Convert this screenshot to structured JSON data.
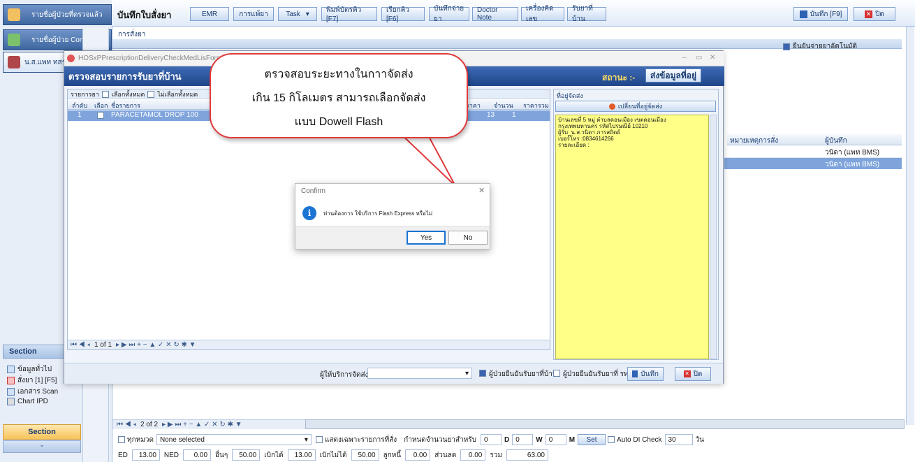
{
  "leftnav": {
    "items": [
      {
        "label": "รายชื่อผู้ป่วยที่ตรวจแล้ว"
      },
      {
        "label": "รายชื่อผู้ป่วย Consult"
      },
      {
        "label": "น.ส.แพท ทสร"
      }
    ],
    "section_title": "Section",
    "section_items": [
      "ข้อมูลทั่วไป",
      "สั่งยา [1] [F5]",
      "เอกสาร Scan",
      "Chart IPD"
    ],
    "section2_title": "Section"
  },
  "toolbar": {
    "title": "บันทึกใบสั่งยา",
    "buttons": [
      "EMR",
      "การแพ้ยา",
      "Task",
      "พิมพ์บัตรคิว [F7]",
      "เรียกคิว [F6]",
      "บันทึกจ่ายยา",
      "Doctor Note",
      "เครื่องคิดเลข",
      "รับยาที่บ้าน"
    ],
    "save": "บันทึก [F9]",
    "close": "ปิด"
  },
  "main": {
    "tab_label": "การสั่งยา",
    "auto_check_label": "ยืนยันจ่ายยาอัตโนมัติ",
    "grid_headers": [
      "หมายเหตุการสั่ง",
      "ผู้บันทึก"
    ],
    "grid_rows": [
      {
        "recorder": "วนิดา (แพท BMS)"
      },
      {
        "recorder": "วนิดา (แพท BMS)"
      }
    ],
    "pager": "2 of 2",
    "bottom1": {
      "all_cat": "ทุกหมวด",
      "none_selected": "None selected",
      "show_ordered": "แสดงเฉพาะรายการที่สั่ง",
      "period_label": "กำหนดจำนวนยาสำหรับ",
      "d_val": "0",
      "d_lbl": "D",
      "w_val": "0",
      "w_lbl": "W",
      "m_val": "0",
      "m_lbl": "M",
      "set_btn": "Set",
      "auto_di": "Auto DI Check",
      "di_days": "30",
      "days": "วัน"
    },
    "bottom2": [
      {
        "label": "ED",
        "value": "13.00"
      },
      {
        "label": "NED",
        "value": "0.00"
      },
      {
        "label": "อื่นๆ",
        "value": "50.00"
      },
      {
        "label": "เบิกได้",
        "value": "13.00"
      },
      {
        "label": "เบิกไม่ได้",
        "value": "50.00"
      },
      {
        "label": "ลูกหนี้",
        "value": "0.00"
      },
      {
        "label": "ส่วนลด",
        "value": "0.00"
      },
      {
        "label": "รวม",
        "value": "63.00"
      }
    ]
  },
  "dialog": {
    "window_title": "HOSxPPrescriptionDeliveryCheckMedLisForm",
    "header": "ตรวจสอบรายการรับยาที่บ้าน",
    "status_label": "สถานะ :-",
    "status_value": "ส่งข้อมูลที่อยู่",
    "list_label": "รายการยา",
    "select_all": "เลือกทั้งหมด",
    "deselect_all": "ไม่เลือกทั้งหมด",
    "cols": [
      "ลำดับ",
      "เลือก",
      "ชื่อรายการ",
      "ราคา",
      "จำนวน",
      "ราคารวม"
    ],
    "rows": [
      {
        "no": "1",
        "name": "PARACETAMOL DROP 100",
        "price": "13",
        "qty": "1"
      }
    ],
    "pager": "1 of 1",
    "address_title": "ที่อยู่จัดส่ง",
    "change_address": "เปลี่ยนที่อยู่จัดส่ง",
    "address_lines": [
      "บ้านเลขที่ 5 หมู่   ตำบลดอนเมือง   เขตดอนเมือง",
      "กรุงเทพมหานคร รหัสไปรษณีย์ 10210",
      "ผู้รับ_น.ส.วนิดา ภารสถิตย์",
      "เบอร์โทร :0834614266",
      "รายละเอียด :"
    ],
    "provider_label": "ผู้ให้บริการจัดส่ง",
    "confirm_home": "ผู้ป่วยยืนยันรับยาที่บ้าน",
    "confirm_hosp": "ผู้ป่วยยืนยันรับยาที่ รพ.",
    "save": "บันทึก",
    "close": "ปิด"
  },
  "bubble": {
    "line1": "ตรวจสอบระยะทางในกาาจัดส่ง",
    "line2": "เกิน 15 กิโลเมตร สามารถเลือกจัดส่ง",
    "line3": "แบบ Dowell Flash"
  },
  "confirm": {
    "title": "Confirm",
    "message": "ท่านต้องการ ใช้บริการ Flash Express หรือไม่",
    "yes": "Yes",
    "no": "No"
  },
  "colors": {
    "accent": "#1f4689",
    "address_bg": "#ffff88",
    "highlight": "#7fa4dc",
    "bubble_border": "#e03a3a"
  }
}
